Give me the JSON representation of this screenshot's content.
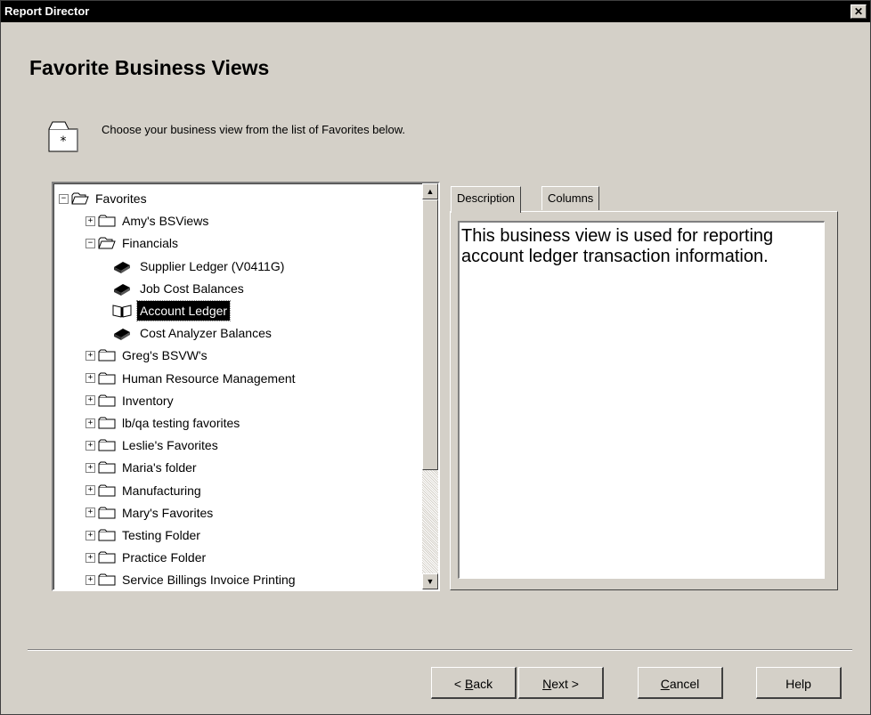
{
  "window": {
    "title": "Report Director",
    "close_label": "✕"
  },
  "page": {
    "heading": "Favorite Business Views",
    "instruction": "Choose your business view from the list of Favorites below."
  },
  "tree": {
    "root": {
      "label": "Favorites",
      "expander": "−"
    },
    "items": [
      {
        "label": "Amy's BSViews",
        "type": "folder",
        "expander": "+"
      },
      {
        "label": "Financials",
        "type": "folder-open",
        "expander": "−"
      },
      {
        "label": "Supplier Ledger (V0411G)",
        "type": "view"
      },
      {
        "label": "Job Cost Balances",
        "type": "view"
      },
      {
        "label": "Account Ledger",
        "type": "view-open",
        "selected": true
      },
      {
        "label": "Cost Analyzer Balances",
        "type": "view"
      },
      {
        "label": "Greg's BSVW's",
        "type": "folder",
        "expander": "+"
      },
      {
        "label": "Human Resource Management",
        "type": "folder",
        "expander": "+"
      },
      {
        "label": "Inventory",
        "type": "folder",
        "expander": "+"
      },
      {
        "label": "lb/qa testing favorites",
        "type": "folder",
        "expander": "+"
      },
      {
        "label": "Leslie's Favorites",
        "type": "folder",
        "expander": "+"
      },
      {
        "label": "Maria's folder",
        "type": "folder",
        "expander": "+"
      },
      {
        "label": "Manufacturing",
        "type": "folder",
        "expander": "+"
      },
      {
        "label": "Mary's Favorites",
        "type": "folder",
        "expander": "+"
      },
      {
        "label": "Testing Folder",
        "type": "folder",
        "expander": "+"
      },
      {
        "label": "Practice Folder",
        "type": "folder",
        "expander": "+"
      },
      {
        "label": "Service Billings Invoice Printing",
        "type": "folder",
        "expander": "+"
      }
    ],
    "scroll_up": "▲",
    "scroll_down": "▼"
  },
  "tabs": [
    {
      "label": "Description",
      "active": true
    },
    {
      "label": "Columns",
      "active": false
    }
  ],
  "description_text": "This business view is used for reporting account ledger transaction information.",
  "buttons": {
    "back_prefix": "< ",
    "back_key": "B",
    "back_rest": "ack",
    "next_key": "N",
    "next_rest": "ext >",
    "cancel_key": "C",
    "cancel_rest": "ancel",
    "help": "Help"
  },
  "icons": {
    "instruction": "favorites-folder-icon",
    "folder": "folder-icon",
    "folder_open": "open-folder-icon",
    "view": "business-view-book-icon"
  }
}
